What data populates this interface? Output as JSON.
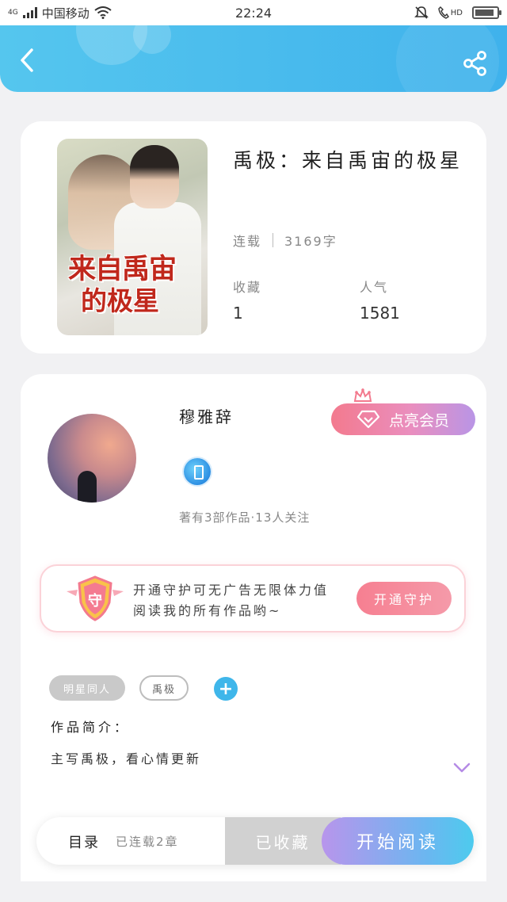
{
  "status_bar": {
    "network": "4G",
    "carrier": "中国移动",
    "time": "22:24",
    "hd_label": "HD",
    "battery_level": 0.9
  },
  "header": {
    "back_icon": "chevron-left-icon",
    "share_icon": "share-icon"
  },
  "book": {
    "cover_title_line1": "来自禹宙",
    "cover_title_line2": "的极星",
    "title": "禹极：来自禹宙的极星",
    "status": "连载",
    "word_count": "3169字",
    "favorites_label": "收藏",
    "favorites_value": "1",
    "popularity_label": "人气",
    "popularity_value": "1581"
  },
  "author": {
    "name": "穆雅辞",
    "vip_button": "点亮会员",
    "stats": "著有3部作品·13人关注"
  },
  "guard": {
    "shield_char": "守",
    "text_line1": "开通守护可无广告无限体力值",
    "text_line2": "阅读我的所有作品哟~",
    "button": "开通守护"
  },
  "tags": {
    "tag1": "明星同人",
    "tag2": "禹极",
    "add_symbol": "+"
  },
  "intro": {
    "label": "作品简介：",
    "text": "主写禹极，看心情更新"
  },
  "bottom_bar": {
    "toc_label": "目录",
    "toc_count": "已连载2章",
    "favorite_button": "已收藏",
    "read_button": "开始阅读"
  },
  "colors": {
    "header_blue": "#3fb2ec",
    "accent_pink": "#f37a8e",
    "accent_purple": "#b995e6",
    "tag_blue": "#3fb6ea"
  }
}
